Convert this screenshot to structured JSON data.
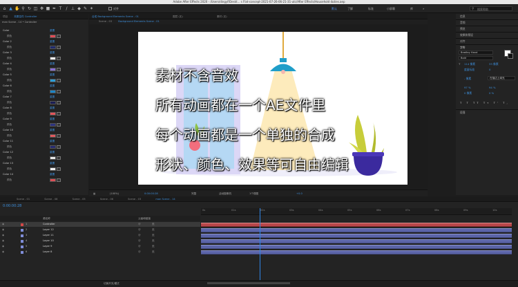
{
  "window": {
    "title": "Adobe After Effects 2020 - /Users/dingyf/Deskt... s Flat-concept-2021-07-26-06-21-31-utc/After Effects/Household duties.aep"
  },
  "toolbar": {
    "snap_label": "对齐",
    "workspaces": [
      "默认",
      "了解",
      "标准",
      "小屏幕",
      "库"
    ],
    "more_label": "»",
    "search_placeholder": "搜索帮助"
  },
  "effect_controls": {
    "tabs": [
      "项目",
      "效果控件 Controller"
    ],
    "breadcrumb": "man Scene - 14 • Controller",
    "colors": [
      {
        "name": "Color",
        "swatch": "#e04c54"
      },
      {
        "name": "Color 2",
        "swatch": "#1f2a6e"
      },
      {
        "name": "Color 3",
        "swatch": "#f2f2f2"
      },
      {
        "name": "Color 4",
        "swatch": "#8a6fd6"
      },
      {
        "name": "Color 5",
        "swatch": "#2c9fd8"
      },
      {
        "name": "Color 6",
        "swatch": "#1b86c8"
      },
      {
        "name": "Color 7",
        "swatch": "#1a1d55"
      },
      {
        "name": "Color 8",
        "swatch": "#e4555a"
      },
      {
        "name": "Color 9",
        "swatch": "#2d3380"
      },
      {
        "name": "Color 10",
        "swatch": "#e05a5e"
      },
      {
        "name": "Color 11",
        "swatch": "#262a70"
      },
      {
        "name": "Color 12",
        "swatch": "#e8e8e8"
      },
      {
        "name": "Color 13",
        "swatch": "#f0f0f0"
      },
      {
        "name": "Color 14",
        "swatch": "#d94f56"
      }
    ],
    "reset_label": "重置",
    "sub_label": "颜色"
  },
  "viewer": {
    "tabs": [
      "合成 Background Elements Scene - 01",
      "图层 (无)",
      "素材 (无)"
    ],
    "sub_tabs": [
      "Scene - 03",
      "Background Elements Scene - 01"
    ],
    "captions": [
      "素材不含音效",
      "所有动画都在一个AE文件里",
      "每个动画都是一个单独的合成",
      "形状、颜色、效果等可自由编辑"
    ],
    "footer": {
      "zoom": "(100%)",
      "timecode": "0:00:00:28",
      "resolution": "完整",
      "camera": "活动摄像机",
      "views": "1个视图",
      "exposure": "+0.0"
    }
  },
  "right_panel": {
    "sections": [
      "信息",
      "音频",
      "预览",
      "效果和预设",
      "对齐",
      "字符"
    ],
    "font_name": "Bradley Hand",
    "font_style": "Bold",
    "size": "114 像素",
    "leading": "33 像素",
    "kerning": "度量标准",
    "tracking": "0",
    "stroke": "- 像素",
    "stroke_mode": "在描边上填充",
    "vscale": "97 %",
    "hscale": "94 %",
    "baseline": "0 像素",
    "tsume": "0 %",
    "para_label": "段落"
  },
  "timeline": {
    "tabs": [
      "Scene - 01",
      "Scene - 08",
      "Scene - 05",
      "Scene - 06",
      "Scene - 03",
      "man Scene - 14"
    ],
    "timecode": "0:00:00:28",
    "columns": {
      "source": "源名称",
      "mode": "父级和链接"
    },
    "layers": [
      {
        "num": "1",
        "name": "Controller",
        "color": "#d14848",
        "selected": true,
        "bar": "red"
      },
      {
        "num": "2",
        "name": "Layer 12",
        "color": "#7f8dd8",
        "selected": false,
        "bar": "blue"
      },
      {
        "num": "3",
        "name": "Layer 11",
        "color": "#7f8dd8",
        "selected": false,
        "bar": "blue"
      },
      {
        "num": "4",
        "name": "Layer 10",
        "color": "#7f8dd8",
        "selected": false,
        "bar": "blue"
      },
      {
        "num": "5",
        "name": "Layer 9",
        "color": "#7f8dd8",
        "selected": false,
        "bar": "blue"
      },
      {
        "num": "6",
        "name": "Layer 8",
        "color": "#7f8dd8",
        "selected": false,
        "bar": "blue"
      }
    ],
    "parent_value": "无",
    "ruler": [
      "0s",
      "01s",
      "02s",
      "03s",
      "04s",
      "05s",
      "06s",
      "07s",
      "08s",
      "09s",
      "10s"
    ],
    "footer": "切换开关/模式"
  }
}
